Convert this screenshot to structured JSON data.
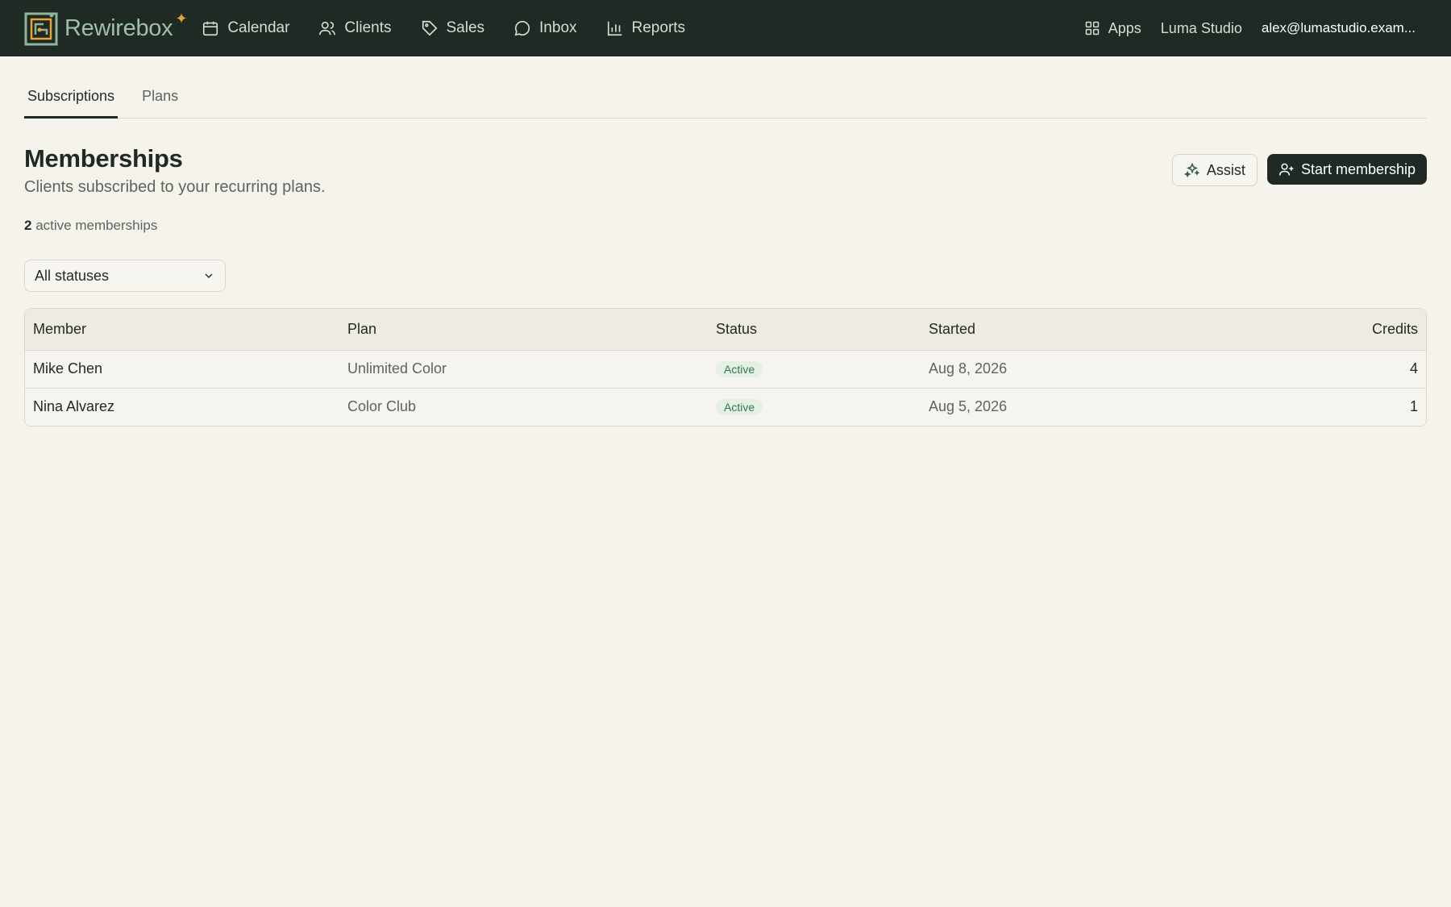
{
  "brand": {
    "name": "Rewirebox",
    "spark": "✦"
  },
  "nav": [
    {
      "label": "Calendar",
      "icon": "calendar-icon"
    },
    {
      "label": "Clients",
      "icon": "users-icon"
    },
    {
      "label": "Sales",
      "icon": "tag-icon"
    },
    {
      "label": "Inbox",
      "icon": "message-icon"
    },
    {
      "label": "Reports",
      "icon": "bar-chart-icon"
    }
  ],
  "topbar": {
    "apps_label": "Apps",
    "studio": "Luma Studio",
    "email": "alex@lumastudio.exam..."
  },
  "tabs": [
    {
      "label": "Subscriptions",
      "active": true
    },
    {
      "label": "Plans",
      "active": false
    }
  ],
  "page": {
    "title": "Memberships",
    "subtitle": "Clients subscribed to your recurring plans.",
    "count": "2",
    "count_suffix": " active memberships"
  },
  "actions": {
    "assist_label": "Assist",
    "primary_label": "Start membership"
  },
  "filter": {
    "value": "All statuses"
  },
  "table": {
    "columns": [
      "Member",
      "Plan",
      "Status",
      "Started",
      "Credits"
    ],
    "rows": [
      {
        "member": "Mike Chen",
        "plan": "Unlimited Color",
        "status": "Active",
        "started": "Aug 8, 2026",
        "credits": "4"
      },
      {
        "member": "Nina Alvarez",
        "plan": "Color Club",
        "status": "Active",
        "started": "Aug 5, 2026",
        "credits": "1"
      }
    ]
  },
  "colors": {
    "topbar": "#1f2a24",
    "background": "#f5f3ec",
    "accent": "#e8a43a",
    "status_active": "#2f7a4e"
  }
}
